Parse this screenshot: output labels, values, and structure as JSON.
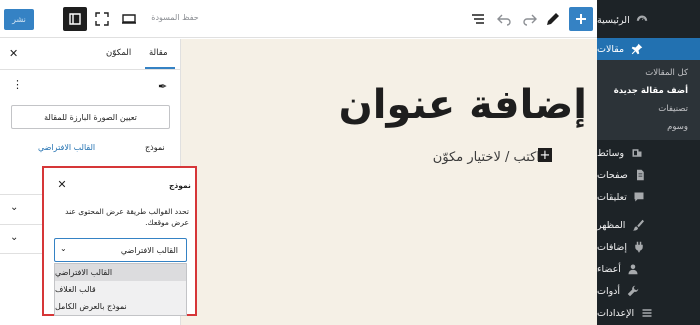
{
  "admin_menu": {
    "dashboard": "الرئيسية",
    "posts": "مقالات",
    "posts_sub": [
      "كل المقالات",
      "أضف مقالة جديدة",
      "تصنيفات",
      "وسوم"
    ],
    "media": "وسائط",
    "pages": "صفحات",
    "comments": "تعليقات",
    "appearance": "المظهر",
    "plugins": "إضافات",
    "users": "أعضاء",
    "tools": "أدوات",
    "settings": "الإعدادات"
  },
  "toolbar": {
    "publish_label": "نشر",
    "save_draft_label": "حفظ المسودة"
  },
  "settings_panel": {
    "tab_post": "مقالة",
    "tab_block": "المكوّن",
    "featured_image_button": "تعيين الصورة البارزة للمقالة",
    "template_label": "نموذج",
    "template_value": "القالب الافتراضي"
  },
  "canvas": {
    "post_title": "إضافة عنوان",
    "block_placeholder": "اكتب / لاختيار مكوّن"
  },
  "template_popover": {
    "title": "نموذج",
    "description": "تحدد القوالب طريقة عرض المحتوى عند عرض موقعك.",
    "selected_value": "القالب الافتراضي",
    "options": [
      "القالب الافتراضي",
      "قالب الغلاف",
      "نموذج بالعرض الكامل"
    ]
  },
  "colors": {
    "accent": "#3582c4",
    "highlight_border": "#d63638",
    "admin_bar": "#1d2327",
    "canvas_bg": "#f5f0e6"
  }
}
